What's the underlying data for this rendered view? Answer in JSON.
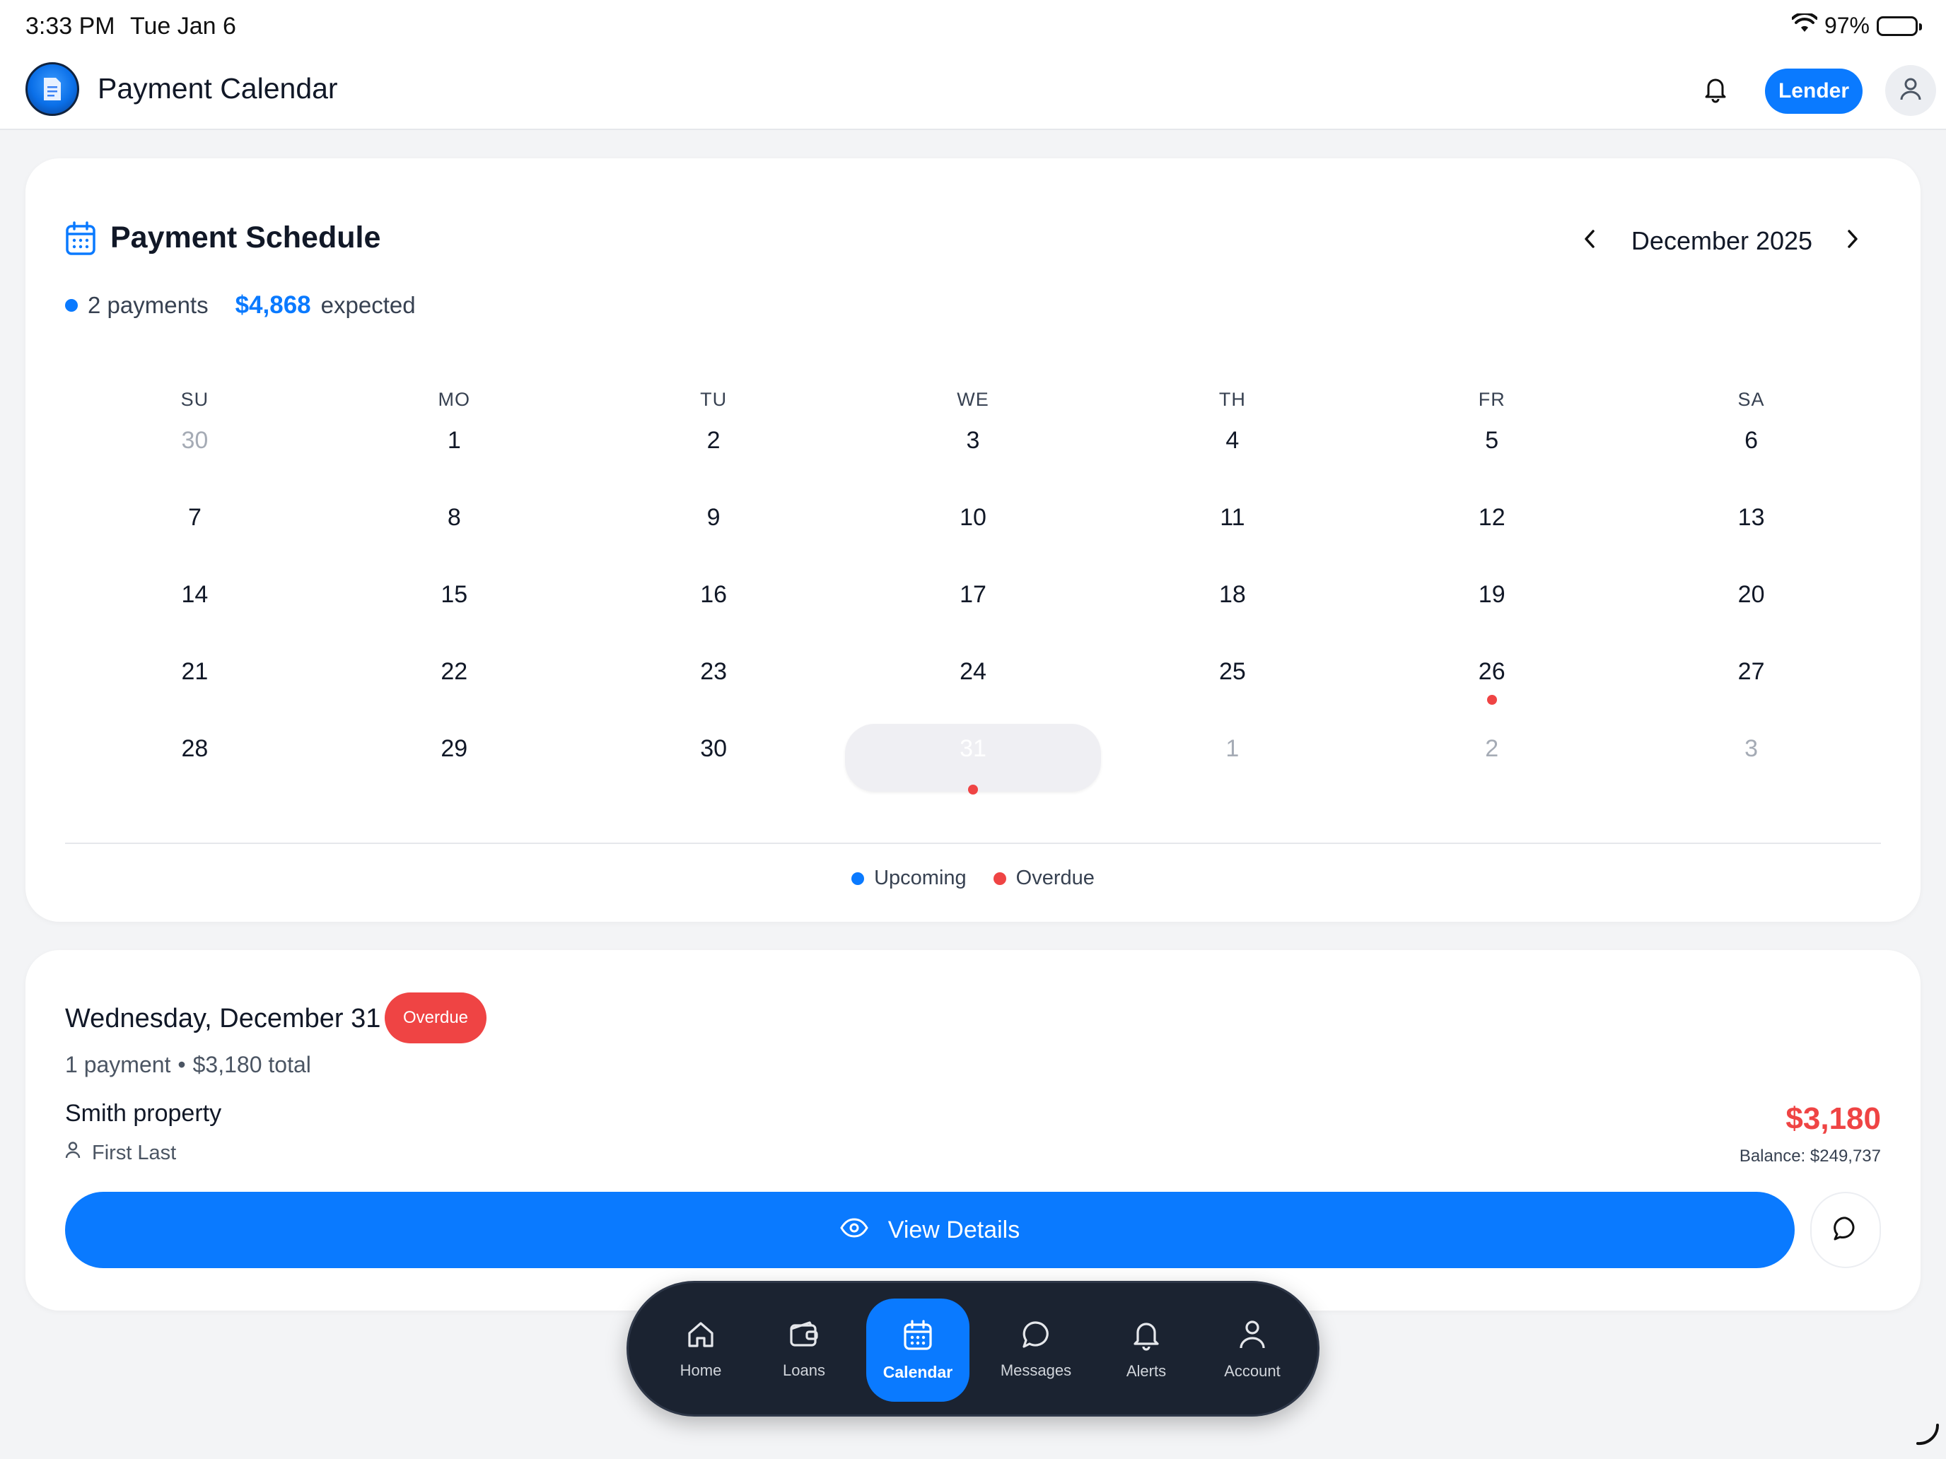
{
  "status_bar": {
    "time": "3:33 PM",
    "date": "Tue Jan 6",
    "battery": "97%",
    "icons": [
      "wifi-icon",
      "battery-icon"
    ]
  },
  "header": {
    "title": "Payment Calendar",
    "role_button": "Lender",
    "icons": [
      "app-logo-icon",
      "bell-icon",
      "user-icon"
    ]
  },
  "schedule": {
    "title": "Payment Schedule",
    "month": "December 2025",
    "payments_count": "2 payments",
    "expected_amount": "$4,868",
    "expected_label": "expected",
    "weekdays": [
      "SU",
      "MO",
      "TU",
      "WE",
      "TH",
      "FR",
      "SA"
    ],
    "days": [
      {
        "d": "30",
        "muted": true
      },
      {
        "d": "1"
      },
      {
        "d": "2"
      },
      {
        "d": "3"
      },
      {
        "d": "4"
      },
      {
        "d": "5"
      },
      {
        "d": "6"
      },
      {
        "d": "7"
      },
      {
        "d": "8"
      },
      {
        "d": "9"
      },
      {
        "d": "10"
      },
      {
        "d": "11"
      },
      {
        "d": "12"
      },
      {
        "d": "13"
      },
      {
        "d": "14"
      },
      {
        "d": "15"
      },
      {
        "d": "16"
      },
      {
        "d": "17"
      },
      {
        "d": "18"
      },
      {
        "d": "19"
      },
      {
        "d": "20"
      },
      {
        "d": "21"
      },
      {
        "d": "22"
      },
      {
        "d": "23"
      },
      {
        "d": "24"
      },
      {
        "d": "25"
      },
      {
        "d": "26",
        "dot": "overdue"
      },
      {
        "d": "27"
      },
      {
        "d": "28"
      },
      {
        "d": "29"
      },
      {
        "d": "30"
      },
      {
        "d": "31",
        "dot": "overdue",
        "selected": true
      },
      {
        "d": "1",
        "muted": true
      },
      {
        "d": "2",
        "muted": true
      },
      {
        "d": "3",
        "muted": true
      }
    ],
    "legend": [
      {
        "label": "Upcoming",
        "color": "#0a7aff"
      },
      {
        "label": "Overdue",
        "color": "#ef4444"
      }
    ]
  },
  "detail": {
    "date": "Wednesday, December 31",
    "badge": "Overdue",
    "summary_count": "1 payment",
    "summary_bullet": "•",
    "summary_total": "$3,180 total",
    "property": "Smith property",
    "borrower": "First Last",
    "amount": "$3,180",
    "balance": "Balance: $249,737",
    "view_button": "View Details"
  },
  "tabbar": {
    "tabs": [
      {
        "label": "Home",
        "icon": "home-icon"
      },
      {
        "label": "Loans",
        "icon": "wallet-icon"
      },
      {
        "label": "Calendar",
        "icon": "calendar-icon",
        "active": true
      },
      {
        "label": "Messages",
        "icon": "chat-icon"
      },
      {
        "label": "Alerts",
        "icon": "bell-icon"
      },
      {
        "label": "Account",
        "icon": "user-icon"
      }
    ]
  },
  "colors": {
    "accent": "#0a7aff",
    "overdue": "#ef4444",
    "tabbar_bg": "#1b2331"
  }
}
